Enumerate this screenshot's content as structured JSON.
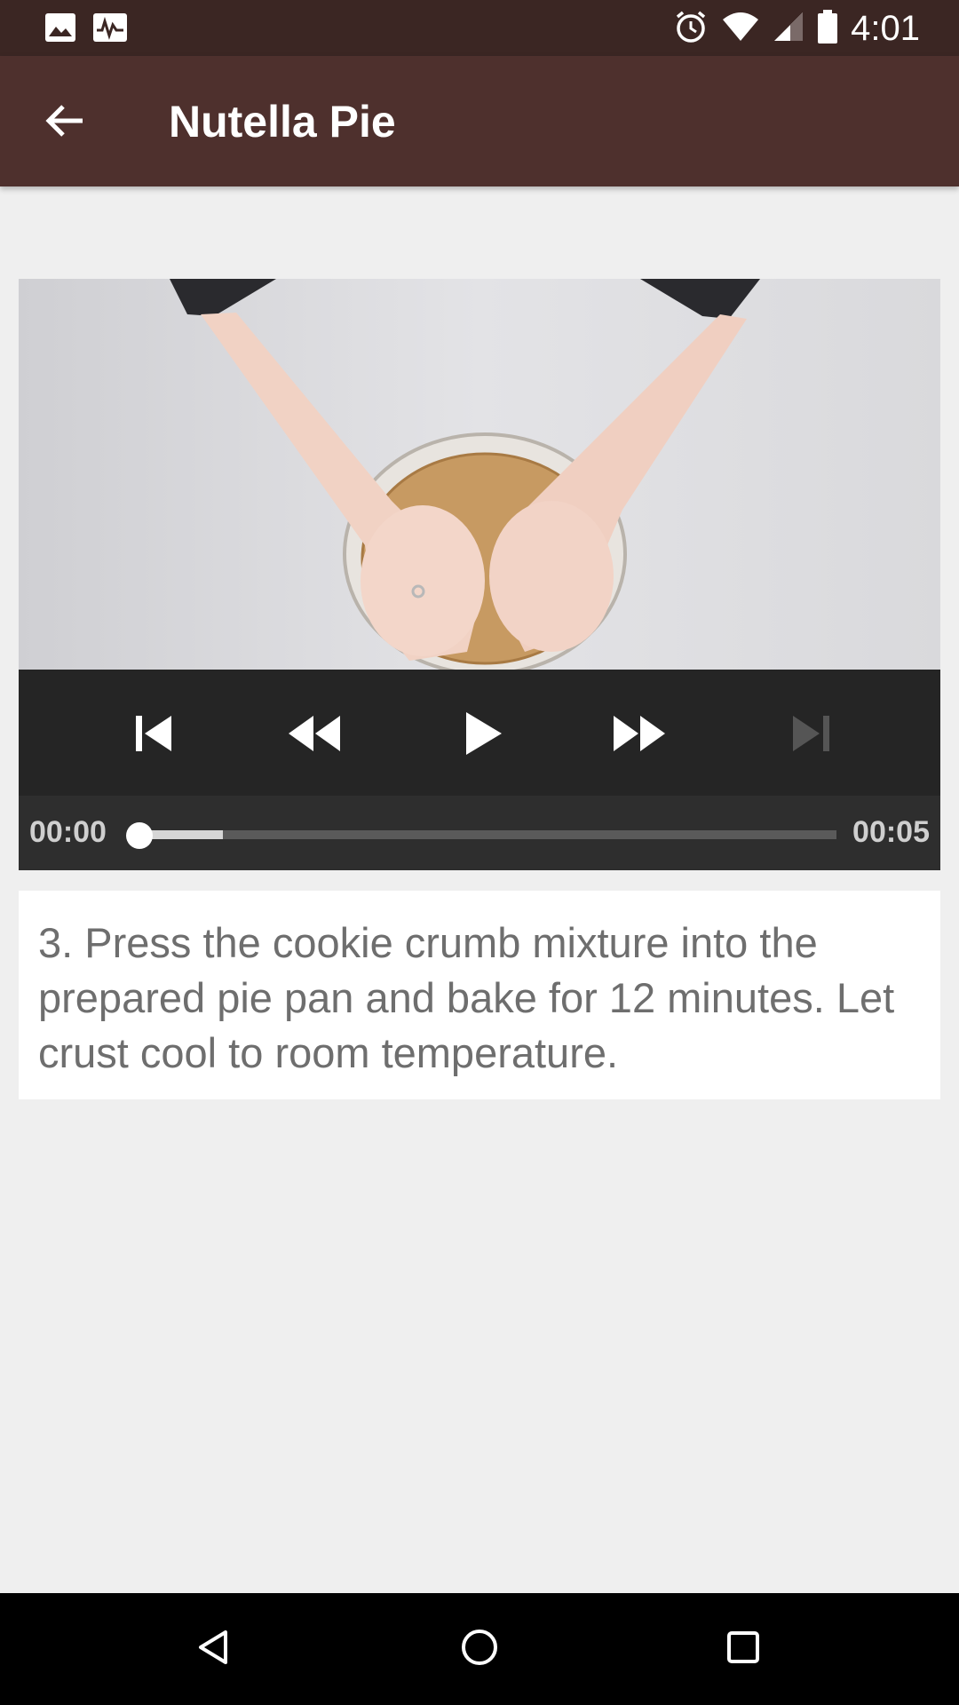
{
  "status_bar": {
    "time": "4:01",
    "left_icons": [
      "image-icon",
      "activity-icon"
    ],
    "right_icons": [
      "alarm-icon",
      "wifi-icon",
      "signal-icon",
      "battery-icon"
    ]
  },
  "app_bar": {
    "back_icon": "arrow-back-icon",
    "title": "Nutella Pie"
  },
  "player": {
    "buttons": [
      "skip-previous-icon",
      "rewind-icon",
      "play-icon",
      "fast-forward-icon",
      "skip-next-icon"
    ],
    "current_time": "00:00",
    "duration": "00:05",
    "progress_fraction": 0.0,
    "buffered_fraction": 0.12
  },
  "step": {
    "text": "3. Press the cookie crumb mixture into the prepared pie pan and bake for 12 minutes. Let crust cool to room temperature."
  },
  "nav_bar": {
    "buttons": [
      "back-triangle-icon",
      "home-circle-icon",
      "recents-square-icon"
    ]
  },
  "colors": {
    "status_bar": "#3b2623",
    "app_bar": "#4e302d",
    "background": "#efefef",
    "controls": "#252525"
  }
}
